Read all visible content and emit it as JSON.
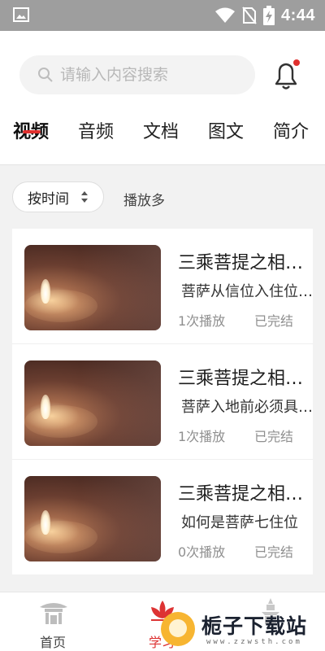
{
  "status_bar": {
    "time": "4:44"
  },
  "search": {
    "placeholder": "请输入内容搜索"
  },
  "tabs": [
    {
      "label": "视频",
      "active": true
    },
    {
      "label": "音频"
    },
    {
      "label": "文档"
    },
    {
      "label": "图文"
    },
    {
      "label": "简介"
    }
  ],
  "sort": {
    "by_time": "按时间",
    "most_played": "播放多"
  },
  "items": [
    {
      "title": "三乘菩提之相应篇",
      "subtitle": "菩萨从信位入住位的条件",
      "plays": "1次播放",
      "status": "已完结"
    },
    {
      "title": "三乘菩提之相应篇",
      "subtitle": "菩萨入地前必须具备的条件",
      "plays": "1次播放",
      "status": "已完结"
    },
    {
      "title": "三乘菩提之相应篇",
      "subtitle": "如何是菩萨七住位",
      "plays": "0次播放",
      "status": "已完结"
    }
  ],
  "bottom_nav": {
    "home": "首页",
    "study": "学习"
  },
  "watermark": {
    "name": "栀子下载站",
    "url": "www.zzwsth.com"
  },
  "colors": {
    "accent": "#e0302e",
    "status_bar": "#9e9e9e"
  }
}
